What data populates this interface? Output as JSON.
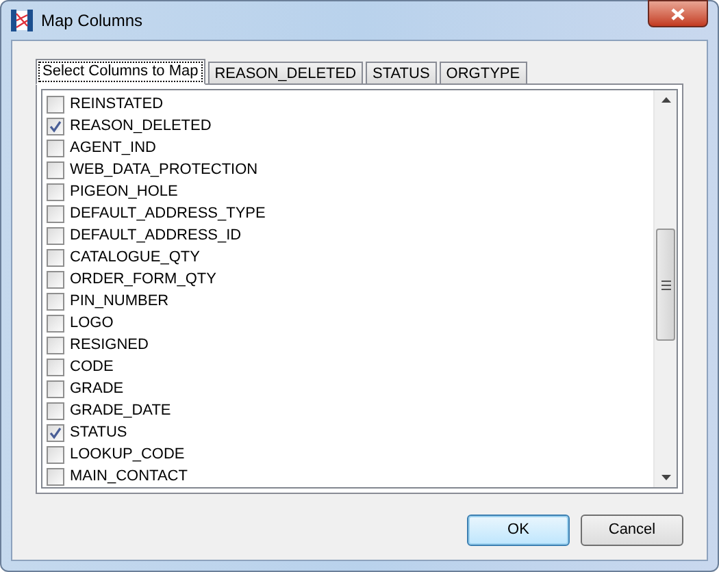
{
  "window": {
    "title": "Map Columns"
  },
  "tabs": [
    {
      "label": "Select Columns to Map",
      "selected": true
    },
    {
      "label": "REASON_DELETED",
      "selected": false
    },
    {
      "label": "STATUS",
      "selected": false
    },
    {
      "label": "ORGTYPE",
      "selected": false
    }
  ],
  "columns": [
    {
      "label": "REINSTATED",
      "checked": false
    },
    {
      "label": "REASON_DELETED",
      "checked": true
    },
    {
      "label": "AGENT_IND",
      "checked": false
    },
    {
      "label": "WEB_DATA_PROTECTION",
      "checked": false
    },
    {
      "label": "PIGEON_HOLE",
      "checked": false
    },
    {
      "label": "DEFAULT_ADDRESS_TYPE",
      "checked": false
    },
    {
      "label": "DEFAULT_ADDRESS_ID",
      "checked": false
    },
    {
      "label": "CATALOGUE_QTY",
      "checked": false
    },
    {
      "label": "ORDER_FORM_QTY",
      "checked": false
    },
    {
      "label": "PIN_NUMBER",
      "checked": false
    },
    {
      "label": "LOGO",
      "checked": false
    },
    {
      "label": "RESIGNED",
      "checked": false
    },
    {
      "label": "CODE",
      "checked": false
    },
    {
      "label": "GRADE",
      "checked": false
    },
    {
      "label": "GRADE_DATE",
      "checked": false
    },
    {
      "label": "STATUS",
      "checked": true
    },
    {
      "label": "LOOKUP_CODE",
      "checked": false
    },
    {
      "label": "MAIN_CONTACT",
      "checked": false
    }
  ],
  "buttons": [
    {
      "label": "OK",
      "default": true
    },
    {
      "label": "Cancel",
      "default": false
    }
  ]
}
